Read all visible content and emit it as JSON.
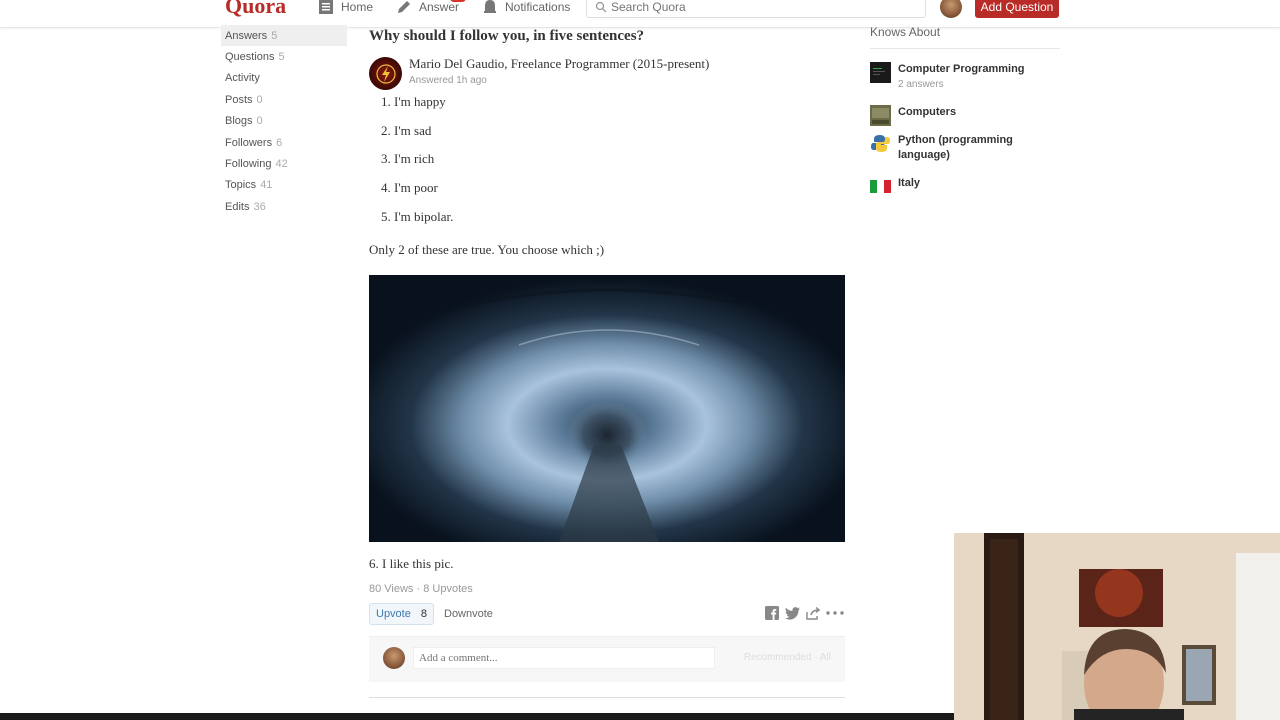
{
  "header": {
    "logo": "Quora",
    "nav": {
      "home": "Home",
      "answer": "Answer",
      "notifications": "Notifications"
    },
    "search_placeholder": "Search Quora",
    "add_question": "Add Question"
  },
  "sidebar": {
    "items": [
      {
        "label": "Answers",
        "count": "5",
        "active": true
      },
      {
        "label": "Questions",
        "count": "5"
      },
      {
        "label": "Activity",
        "count": ""
      },
      {
        "label": "Posts",
        "count": "0"
      },
      {
        "label": "Blogs",
        "count": "0"
      },
      {
        "label": "Followers",
        "count": "6"
      },
      {
        "label": "Following",
        "count": "42"
      },
      {
        "label": "Topics",
        "count": "41"
      },
      {
        "label": "Edits",
        "count": "36"
      }
    ]
  },
  "answer": {
    "question": "Why should I follow you, in five sentences?",
    "author": "Mario Del Gaudio, Freelance Programmer (2015-present)",
    "answered": "Answered 1h ago",
    "list": [
      "I'm happy",
      "I'm sad",
      "I'm rich",
      "I'm poor",
      "I'm bipolar."
    ],
    "list_numbers": [
      "1.",
      "2.",
      "3.",
      "4.",
      "5."
    ],
    "note": "Only 2 of these are true. You choose which ;)",
    "after_image": "6. I like this pic.",
    "stats": "80 Views · 8 Upvotes",
    "upvote_label": "Upvote",
    "upvote_count": "8",
    "downvote_label": "Downvote",
    "comment_placeholder": "Add a comment...",
    "recommended": "Recommended · All"
  },
  "knows_about": {
    "title": "Knows About",
    "topics": [
      {
        "name": "Computer Programming",
        "sub": "2 answers",
        "icon": "code-icon"
      },
      {
        "name": "Computers",
        "sub": "",
        "icon": "computer-icon"
      },
      {
        "name": "Python (programming language)",
        "sub": "",
        "icon": "python-icon"
      },
      {
        "name": "Italy",
        "sub": "",
        "icon": "italy-flag-icon"
      }
    ]
  },
  "colors": {
    "brand": "#b92b27",
    "link": "#3e78b2"
  }
}
